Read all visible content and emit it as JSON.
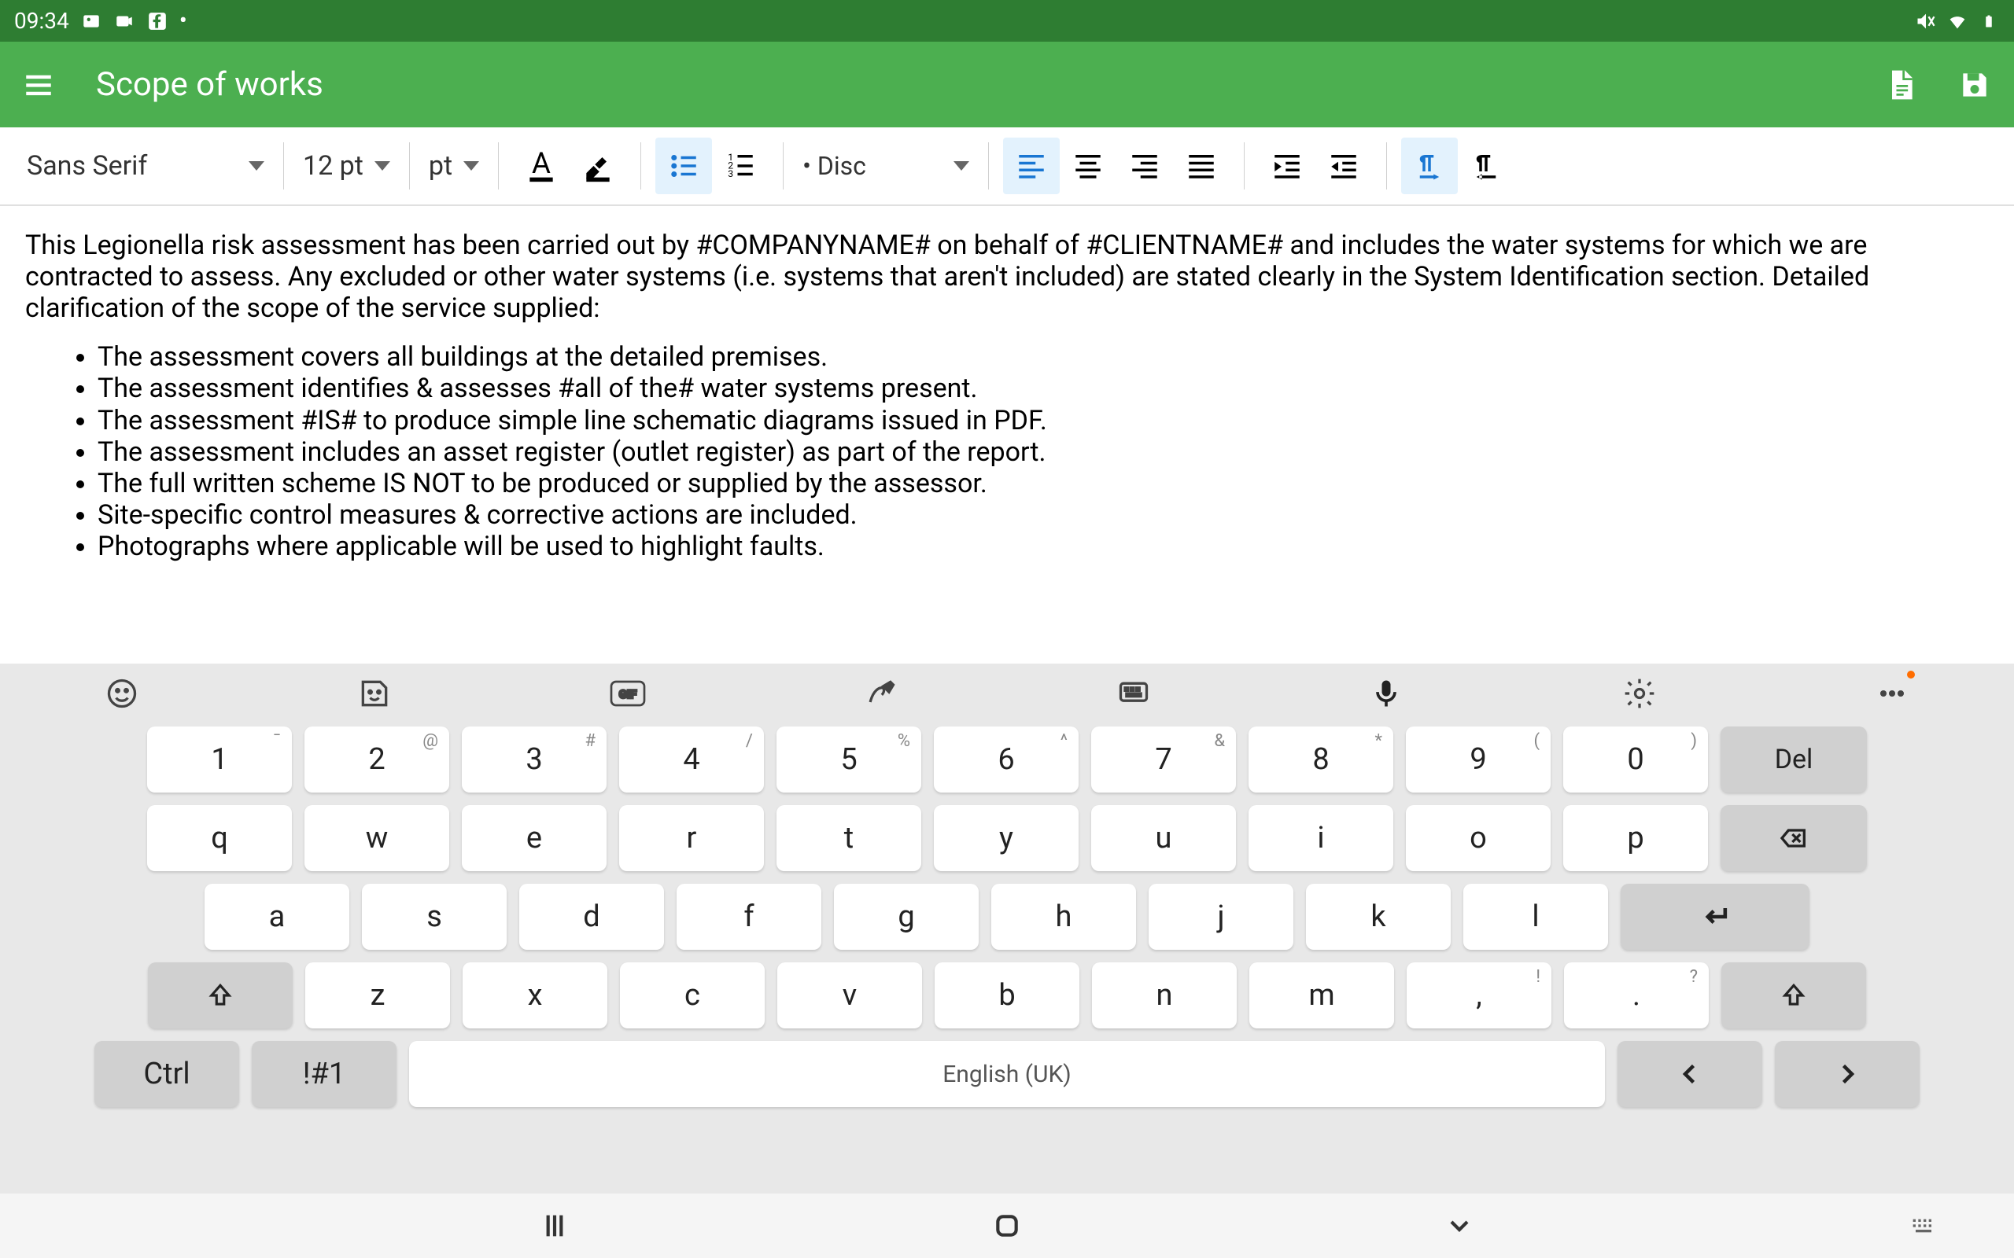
{
  "status": {
    "time": "09:34"
  },
  "app_bar": {
    "title": "Scope of works"
  },
  "toolbar": {
    "font_family": "Sans Serif",
    "font_size": "12 pt",
    "size_unit": "pt",
    "list_style": "• Disc"
  },
  "document": {
    "paragraph": "This Legionella risk assessment has been carried out by #COMPANYNAME# on behalf of #CLIENTNAME# and includes the water systems for which we are contracted to assess. Any excluded or other water systems (i.e. systems that aren't included) are stated clearly in the System Identification section. Detailed clarification of the scope of the service supplied:",
    "bullets": [
      "The assessment covers all buildings at the detailed premises.",
      "The assessment identifies & assesses #all of the# water systems present.",
      "The assessment #IS# to produce simple line schematic diagrams issued in PDF.",
      "The assessment includes an asset register (outlet register) as part of the report.",
      "The full written scheme IS NOT to be produced or supplied by the assessor.",
      "Site-specific control measures & corrective actions are included.",
      "Photographs where applicable will be used to highlight faults."
    ]
  },
  "keyboard": {
    "row1": [
      {
        "main": "1",
        "alt": "¯"
      },
      {
        "main": "2",
        "alt": "@"
      },
      {
        "main": "3",
        "alt": "#"
      },
      {
        "main": "4",
        "alt": "/"
      },
      {
        "main": "5",
        "alt": "%"
      },
      {
        "main": "6",
        "alt": "^"
      },
      {
        "main": "7",
        "alt": "&"
      },
      {
        "main": "8",
        "alt": "*"
      },
      {
        "main": "9",
        "alt": "("
      },
      {
        "main": "0",
        "alt": ")"
      }
    ],
    "del_label": "Del",
    "row2": [
      "q",
      "w",
      "e",
      "r",
      "t",
      "y",
      "u",
      "i",
      "o",
      "p"
    ],
    "row3": [
      "a",
      "s",
      "d",
      "f",
      "g",
      "h",
      "j",
      "k",
      "l"
    ],
    "row4": [
      "z",
      "x",
      "c",
      "v",
      "b",
      "n",
      "m"
    ],
    "row4_punct": [
      {
        "main": ",",
        "alt": "!"
      },
      {
        "main": ".",
        "alt": "?"
      }
    ],
    "ctrl_label": "Ctrl",
    "sym_label": "!#1",
    "space_label": "English (UK)"
  }
}
